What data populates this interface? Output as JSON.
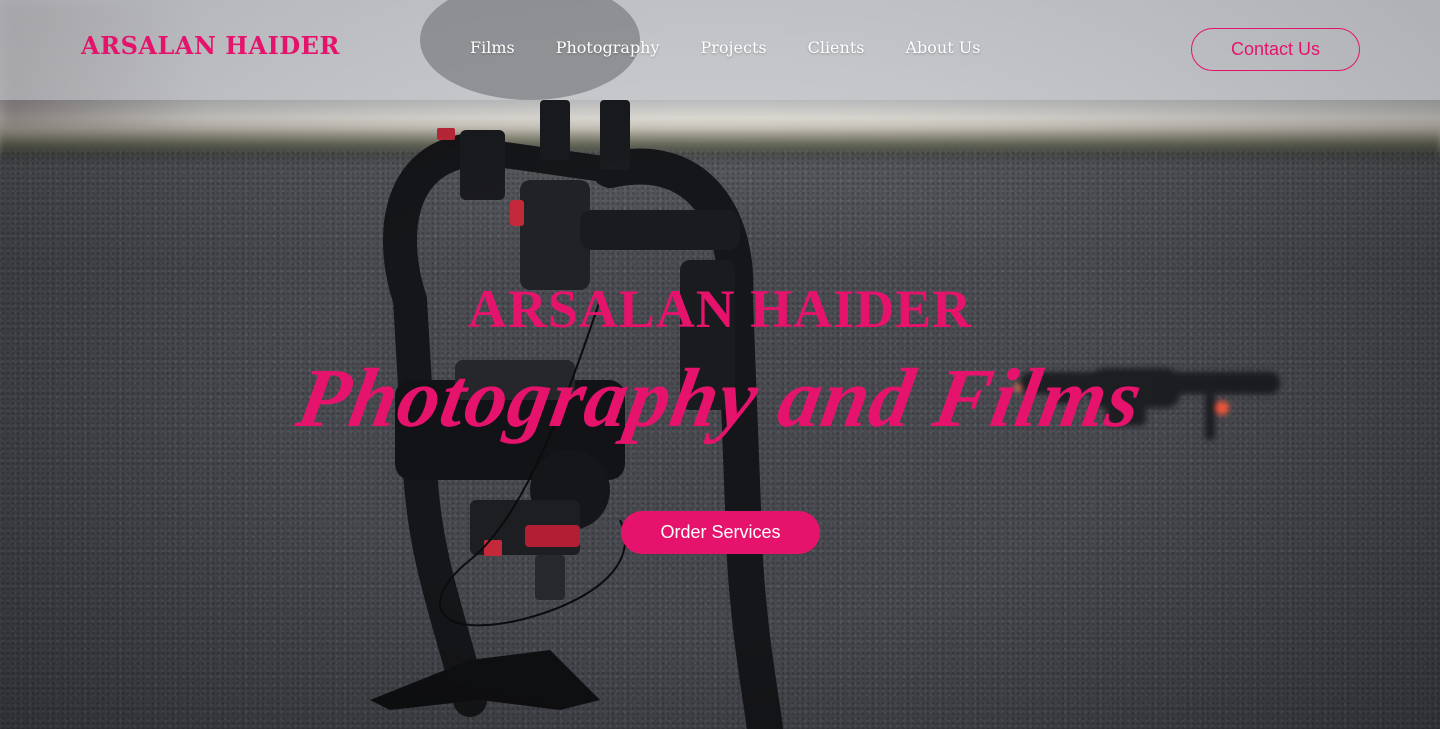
{
  "header": {
    "brand": "ARSALAN HAIDER",
    "nav": [
      {
        "label": "Films"
      },
      {
        "label": "Photography"
      },
      {
        "label": "Projects"
      },
      {
        "label": "Clients"
      },
      {
        "label": "About Us"
      }
    ],
    "contact_label": "Contact Us"
  },
  "hero": {
    "name": "ARSALAN HAIDER",
    "tagline": "Photography and Films",
    "cta_label": "Order Services",
    "background_image": "camera-gimbal-and-drone-on-asphalt"
  },
  "colors": {
    "accent": "#e6136d",
    "header_bg": "#d2d3d8",
    "nav_text": "#ffffff"
  }
}
